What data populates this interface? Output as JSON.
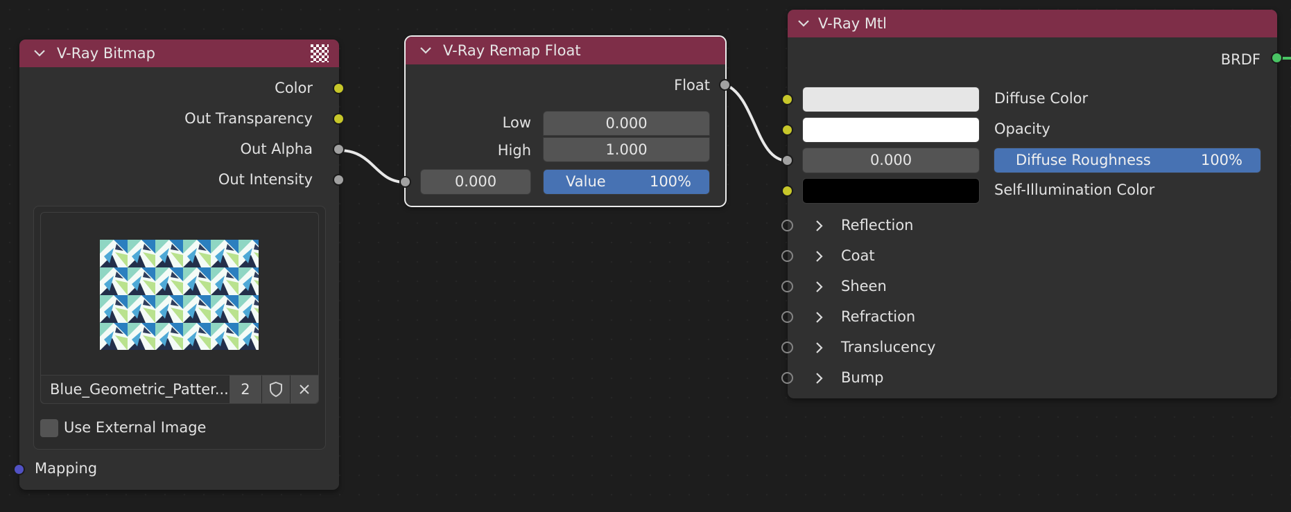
{
  "colors": {
    "background": "#1d1d1d",
    "node_body": "#303030",
    "node_header": "#7e2e48",
    "socket_color": "#c7c72a",
    "socket_float": "#a1a1a1",
    "socket_vector": "#5151c4",
    "socket_shader": "#49c464",
    "slider_fill": "#4772b3",
    "field_bg": "#545454"
  },
  "bitmap_node": {
    "title": "V-Ray Bitmap",
    "outputs": [
      "Color",
      "Out Transparency",
      "Out Alpha",
      "Out Intensity"
    ],
    "image_name": "Blue_Geometric_Patter...",
    "user_count": "2",
    "use_external_label": "Use External Image",
    "use_external_checked": false,
    "mapping_label": "Mapping"
  },
  "remap_node": {
    "title": "V-Ray Remap Float",
    "output": "Float",
    "low_label": "Low",
    "low_value": "0.000",
    "high_label": "High",
    "high_value": "1.000",
    "input_value": "0.000",
    "value_label": "Value",
    "value_percent": "100%",
    "value_fraction": 1.0
  },
  "mtl_node": {
    "title": "V-Ray Mtl",
    "output": "BRDF",
    "diffuse_color_label": "Diffuse Color",
    "diffuse_color": "#e6e6e6",
    "opacity_label": "Opacity",
    "opacity_color": "#ffffff",
    "roughness_input_value": "0.000",
    "roughness_label": "Diffuse Roughness",
    "roughness_percent": "100%",
    "self_illum_label": "Self-Illumination Color",
    "self_illum_color": "#000000",
    "panels": [
      "Reflection",
      "Coat",
      "Sheen",
      "Refraction",
      "Translucency",
      "Bump"
    ]
  }
}
